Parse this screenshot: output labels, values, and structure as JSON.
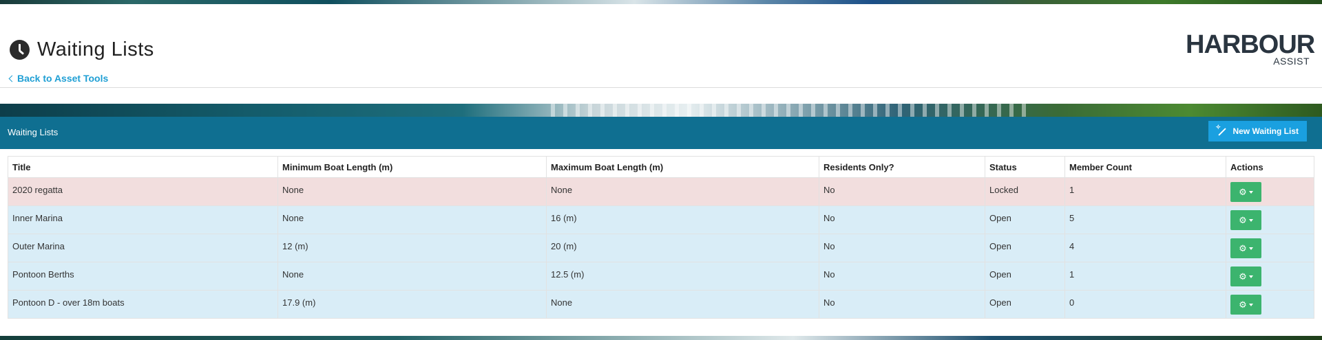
{
  "header": {
    "title": "Waiting Lists",
    "back_link": "Back to Asset Tools",
    "logo_main": "HARBOUR",
    "logo_sub": "ASSIST"
  },
  "panel": {
    "title": "Waiting Lists",
    "new_button_label": "New Waiting List"
  },
  "table": {
    "columns": [
      "Title",
      "Minimum Boat Length (m)",
      "Maximum Boat Length (m)",
      "Residents Only?",
      "Status",
      "Member Count",
      "Actions"
    ],
    "rows": [
      {
        "title": "2020 regatta",
        "min": "None",
        "max": "None",
        "residents": "No",
        "status": "Locked",
        "count": "1",
        "style": "danger"
      },
      {
        "title": "Inner Marina",
        "min": "None",
        "max": "16 (m)",
        "residents": "No",
        "status": "Open",
        "count": "5",
        "style": "info"
      },
      {
        "title": "Outer Marina",
        "min": "12 (m)",
        "max": "20 (m)",
        "residents": "No",
        "status": "Open",
        "count": "4",
        "style": "info"
      },
      {
        "title": "Pontoon Berths",
        "min": "None",
        "max": "12.5 (m)",
        "residents": "No",
        "status": "Open",
        "count": "1",
        "style": "info"
      },
      {
        "title": "Pontoon D - over 18m boats",
        "min": "17.9 (m)",
        "max": "None",
        "residents": "No",
        "status": "Open",
        "count": "0",
        "style": "info"
      }
    ]
  },
  "colors": {
    "panel_bar": "#0f6f91",
    "new_button": "#1aa0e0",
    "link": "#1f9fd4",
    "action_button": "#3cb46e",
    "row_locked": "#f2dede",
    "row_open": "#d9edf7"
  },
  "icons": {
    "title_icon": "clock-icon",
    "new_button_icon": "magic-wand-icon",
    "action_icon": "gear-icon"
  }
}
